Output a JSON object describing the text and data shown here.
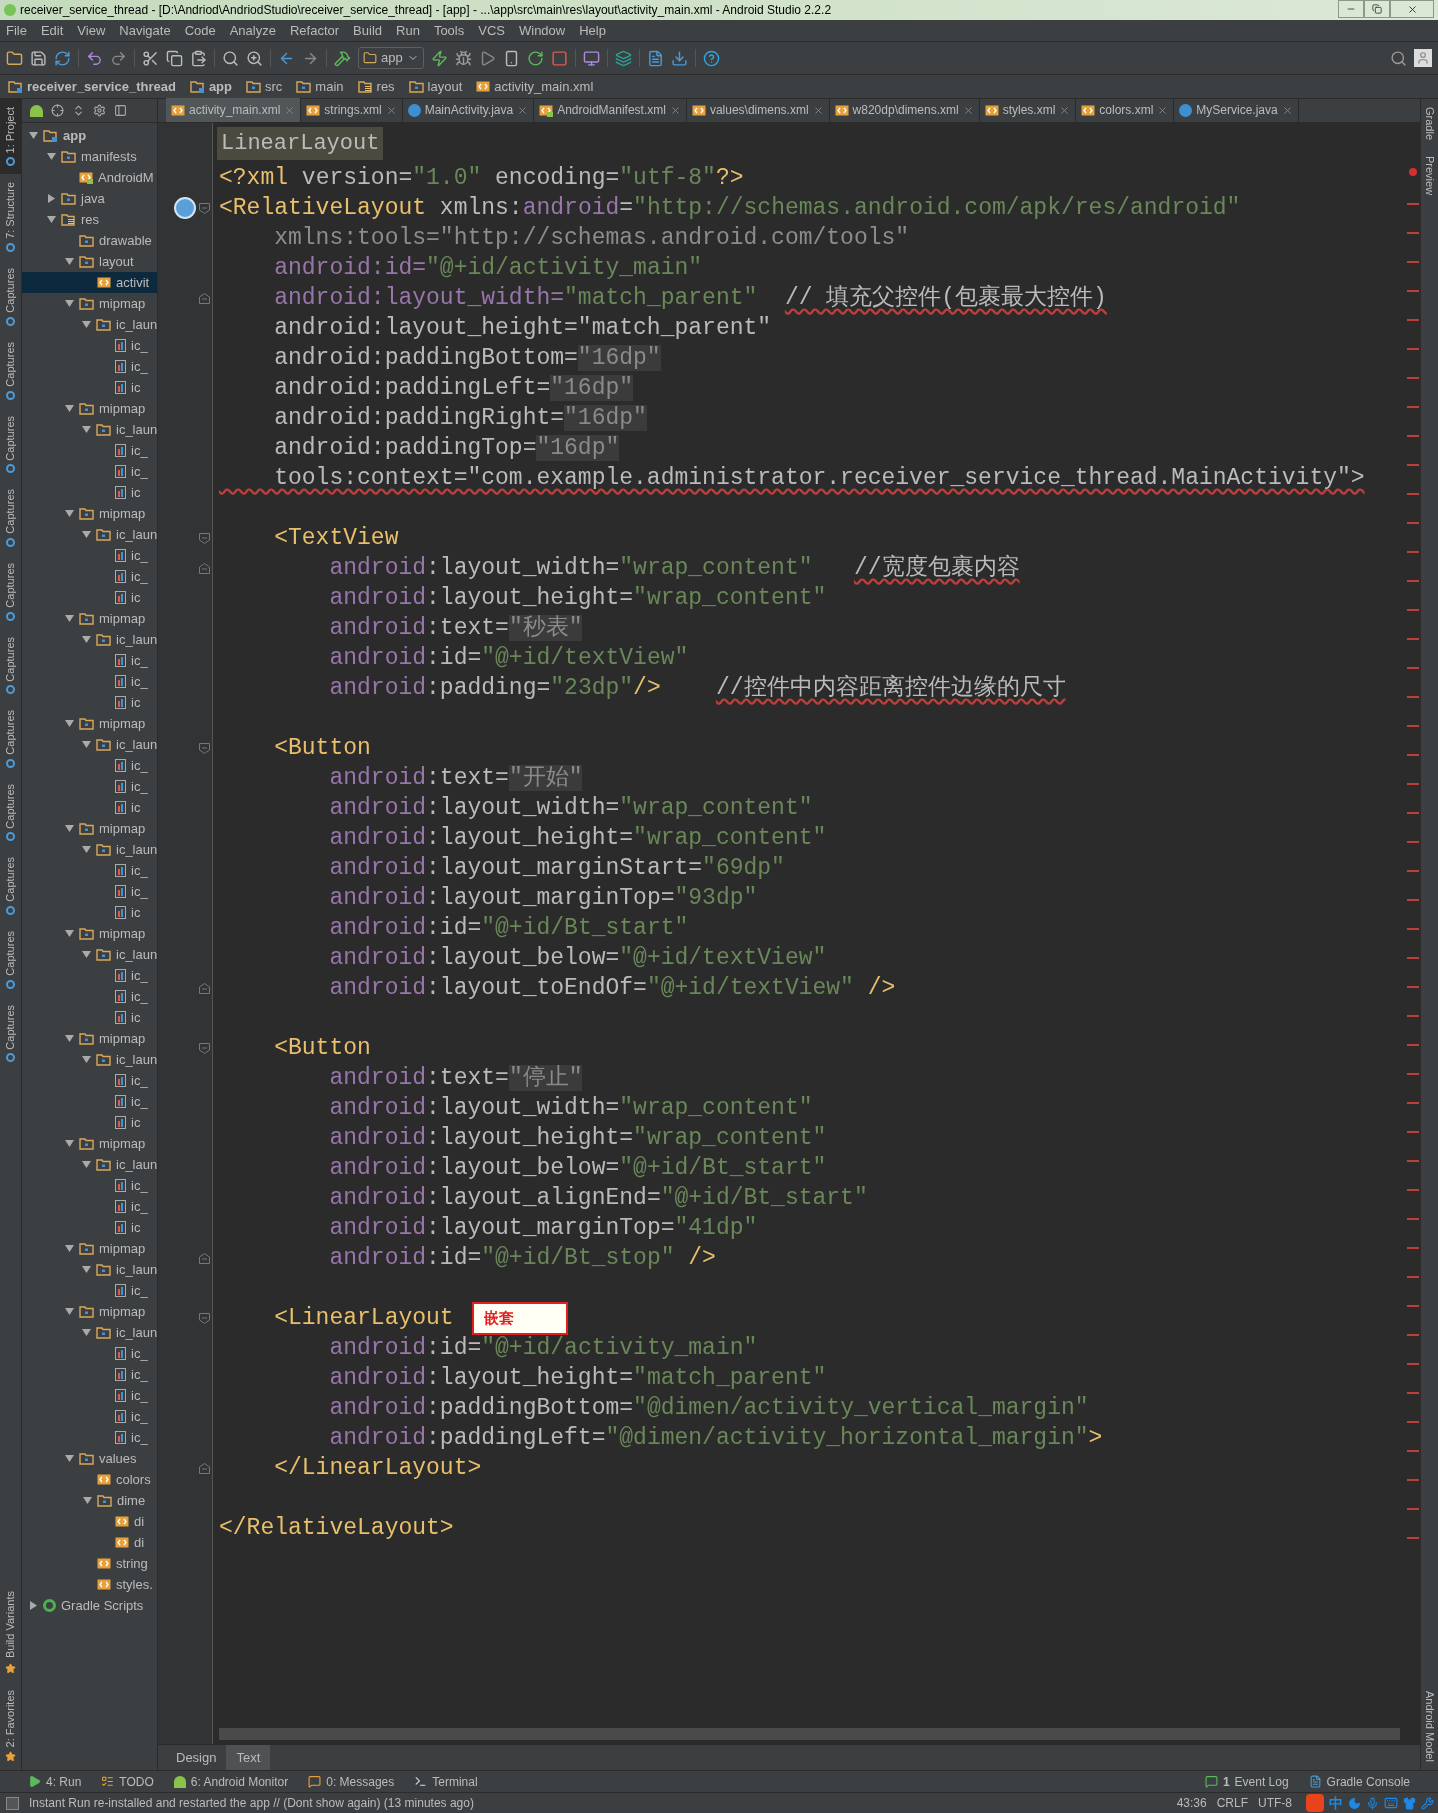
{
  "window": {
    "title": "receiver_service_thread - [D:\\Andriod\\AndriodStudio\\receiver_service_thread] - [app] - ...\\app\\src\\main\\res\\layout\\activity_main.xml - Android Studio 2.2.2"
  },
  "menu": [
    "File",
    "Edit",
    "View",
    "Navigate",
    "Code",
    "Analyze",
    "Refactor",
    "Build",
    "Run",
    "Tools",
    "VCS",
    "Window",
    "Help"
  ],
  "toolbar": {
    "run_config": "app"
  },
  "breadcrumbs": [
    {
      "label": "receiver_service_thread",
      "kind": "module"
    },
    {
      "label": "app",
      "kind": "module"
    },
    {
      "label": "src",
      "kind": "folder"
    },
    {
      "label": "main",
      "kind": "folder"
    },
    {
      "label": "res",
      "kind": "res"
    },
    {
      "label": "layout",
      "kind": "folder"
    },
    {
      "label": "activity_main.xml",
      "kind": "xml"
    }
  ],
  "left_strip": {
    "top": [
      {
        "label": "1: Project",
        "selected": true
      },
      {
        "label": "7: Structure",
        "selected": false
      },
      {
        "label": "Captures",
        "selected": false
      },
      {
        "label": "Captures",
        "selected": false
      },
      {
        "label": "Captures",
        "selected": false
      },
      {
        "label": "Captures",
        "selected": false
      },
      {
        "label": "Captures",
        "selected": false
      },
      {
        "label": "Captures",
        "selected": false
      },
      {
        "label": "Captures",
        "selected": false
      },
      {
        "label": "Captures",
        "selected": false
      },
      {
        "label": "Captures",
        "selected": false
      },
      {
        "label": "Captures",
        "selected": false
      },
      {
        "label": "Captures",
        "selected": false
      }
    ],
    "bottom": [
      {
        "label": "Build Variants",
        "selected": false
      },
      {
        "label": "2: Favorites",
        "selected": false
      }
    ]
  },
  "right_strip": {
    "top": [
      {
        "label": "Gradle"
      },
      {
        "label": "Preview"
      }
    ],
    "bottom": [
      {
        "label": "Android Model"
      }
    ]
  },
  "tree": [
    {
      "label": "app",
      "kind": "module",
      "expanded": true,
      "selected": false,
      "children": [
        {
          "label": "manifests",
          "kind": "folder",
          "expanded": true,
          "selected": false,
          "children": [
            {
              "label": "AndroidM",
              "kind": "manifest",
              "selected": false
            }
          ]
        },
        {
          "label": "java",
          "kind": "folder",
          "expanded": false,
          "selected": false
        },
        {
          "label": "res",
          "kind": "res",
          "expanded": true,
          "selected": false,
          "children": [
            {
              "label": "drawable",
              "kind": "folder",
              "selected": false
            },
            {
              "label": "layout",
              "kind": "folder",
              "expanded": true,
              "selected": false,
              "children": [
                {
                  "label": "activit",
                  "kind": "xml",
                  "selected": true
                }
              ]
            },
            {
              "label": "mipmap",
              "kind": "folder",
              "expanded": true,
              "selected": false,
              "children": [
                {
                  "label": "ic_laun",
                  "kind": "folder",
                  "expanded": true,
                  "selected": false,
                  "children": [
                    {
                      "label": "ic_",
                      "kind": "image",
                      "selected": false
                    },
                    {
                      "label": "ic_",
                      "kind": "image",
                      "selected": false
                    },
                    {
                      "label": "ic",
                      "kind": "image",
                      "selected": false
                    }
                  ]
                }
              ]
            },
            {
              "label": "mipmap",
              "kind": "folder",
              "expanded": true,
              "selected": false,
              "children": [
                {
                  "label": "ic_laun",
                  "kind": "folder",
                  "expanded": true,
                  "selected": false,
                  "children": [
                    {
                      "label": "ic_",
                      "kind": "image",
                      "selected": false
                    },
                    {
                      "label": "ic_",
                      "kind": "image",
                      "selected": false
                    },
                    {
                      "label": "ic",
                      "kind": "image",
                      "selected": false
                    }
                  ]
                }
              ]
            },
            {
              "label": "mipmap",
              "kind": "folder",
              "expanded": true,
              "selected": false,
              "children": [
                {
                  "label": "ic_laun",
                  "kind": "folder",
                  "expanded": true,
                  "selected": false,
                  "children": [
                    {
                      "label": "ic_",
                      "kind": "image",
                      "selected": false
                    },
                    {
                      "label": "ic_",
                      "kind": "image",
                      "selected": false
                    },
                    {
                      "label": "ic",
                      "kind": "image",
                      "selected": false
                    }
                  ]
                }
              ]
            },
            {
              "label": "mipmap",
              "kind": "folder",
              "expanded": true,
              "selected": false,
              "children": [
                {
                  "label": "ic_laun",
                  "kind": "folder",
                  "expanded": true,
                  "selected": false,
                  "children": [
                    {
                      "label": "ic_",
                      "kind": "image",
                      "selected": false
                    },
                    {
                      "label": "ic_",
                      "kind": "image",
                      "selected": false
                    },
                    {
                      "label": "ic",
                      "kind": "image",
                      "selected": false
                    }
                  ]
                }
              ]
            },
            {
              "label": "mipmap",
              "kind": "folder",
              "expanded": true,
              "selected": false,
              "children": [
                {
                  "label": "ic_laun",
                  "kind": "folder",
                  "expanded": true,
                  "selected": false,
                  "children": [
                    {
                      "label": "ic_",
                      "kind": "image",
                      "selected": false
                    },
                    {
                      "label": "ic_",
                      "kind": "image",
                      "selected": false
                    },
                    {
                      "label": "ic",
                      "kind": "image",
                      "selected": false
                    }
                  ]
                }
              ]
            },
            {
              "label": "mipmap",
              "kind": "folder",
              "expanded": true,
              "selected": false,
              "children": [
                {
                  "label": "ic_laun",
                  "kind": "folder",
                  "expanded": true,
                  "selected": false,
                  "children": [
                    {
                      "label": "ic_",
                      "kind": "image",
                      "selected": false
                    },
                    {
                      "label": "ic_",
                      "kind": "image",
                      "selected": false
                    },
                    {
                      "label": "ic",
                      "kind": "image",
                      "selected": false
                    }
                  ]
                }
              ]
            },
            {
              "label": "mipmap",
              "kind": "folder",
              "expanded": true,
              "selected": false,
              "children": [
                {
                  "label": "ic_laun",
                  "kind": "folder",
                  "expanded": true,
                  "selected": false,
                  "children": [
                    {
                      "label": "ic_",
                      "kind": "image",
                      "selected": false
                    },
                    {
                      "label": "ic_",
                      "kind": "image",
                      "selected": false
                    },
                    {
                      "label": "ic",
                      "kind": "image",
                      "selected": false
                    }
                  ]
                }
              ]
            },
            {
              "label": "mipmap",
              "kind": "folder",
              "expanded": true,
              "selected": false,
              "children": [
                {
                  "label": "ic_laun",
                  "kind": "folder",
                  "expanded": true,
                  "selected": false,
                  "children": [
                    {
                      "label": "ic_",
                      "kind": "image",
                      "selected": false
                    },
                    {
                      "label": "ic_",
                      "kind": "image",
                      "selected": false
                    },
                    {
                      "label": "ic",
                      "kind": "image",
                      "selected": false
                    }
                  ]
                }
              ]
            },
            {
              "label": "mipmap",
              "kind": "folder",
              "expanded": true,
              "selected": false,
              "children": [
                {
                  "label": "ic_laun",
                  "kind": "folder",
                  "expanded": true,
                  "selected": false,
                  "children": [
                    {
                      "label": "ic_",
                      "kind": "image",
                      "selected": false
                    },
                    {
                      "label": "ic_",
                      "kind": "image",
                      "selected": false
                    },
                    {
                      "label": "ic",
                      "kind": "image",
                      "selected": false
                    }
                  ]
                }
              ]
            },
            {
              "label": "mipmap",
              "kind": "folder",
              "expanded": true,
              "selected": false,
              "children": [
                {
                  "label": "ic_laun",
                  "kind": "folder",
                  "expanded": true,
                  "selected": false,
                  "children": [
                    {
                      "label": "ic_",
                      "kind": "image",
                      "selected": false
                    }
                  ]
                }
              ]
            },
            {
              "label": "mipmap",
              "kind": "folder",
              "expanded": true,
              "selected": false,
              "children": [
                {
                  "label": "ic_laun",
                  "kind": "folder",
                  "expanded": true,
                  "selected": false,
                  "children": [
                    {
                      "label": "ic_",
                      "kind": "image",
                      "selected": false
                    },
                    {
                      "label": "ic_",
                      "kind": "image",
                      "selected": false
                    },
                    {
                      "label": "ic_",
                      "kind": "image",
                      "selected": false
                    },
                    {
                      "label": "ic_",
                      "kind": "image",
                      "selected": false
                    },
                    {
                      "label": "ic_",
                      "kind": "image",
                      "selected": false
                    }
                  ]
                }
              ]
            },
            {
              "label": "values",
              "kind": "folder",
              "expanded": true,
              "selected": false,
              "children": [
                {
                  "label": "colors",
                  "kind": "xml",
                  "selected": false
                },
                {
                  "label": "dime",
                  "kind": "folder",
                  "expanded": true,
                  "selected": false,
                  "children": [
                    {
                      "label": "di",
                      "kind": "xml",
                      "selected": false
                    },
                    {
                      "label": "di",
                      "kind": "xml",
                      "selected": false
                    }
                  ]
                },
                {
                  "label": "string",
                  "kind": "xml",
                  "selected": false
                },
                {
                  "label": "styles.",
                  "kind": "xml",
                  "selected": false
                }
              ]
            }
          ]
        }
      ]
    },
    {
      "label": "Gradle Scripts",
      "kind": "gradle",
      "expanded": false,
      "selected": false
    }
  ],
  "tabs": [
    {
      "label": "activity_main.xml",
      "kind": "xml",
      "selected": true
    },
    {
      "label": "strings.xml",
      "kind": "xml",
      "selected": false
    },
    {
      "label": "MainActivity.java",
      "kind": "class",
      "selected": false
    },
    {
      "label": "AndroidManifest.xml",
      "kind": "manifest",
      "selected": false
    },
    {
      "label": "values\\dimens.xml",
      "kind": "xml",
      "selected": false
    },
    {
      "label": "w820dp\\dimens.xml",
      "kind": "xml",
      "selected": false
    },
    {
      "label": "styles.xml",
      "kind": "xml",
      "selected": false
    },
    {
      "label": "colors.xml",
      "kind": "xml",
      "selected": false
    },
    {
      "label": "MyService.java",
      "kind": "class",
      "selected": false
    }
  ],
  "editor": {
    "breadcrumb": "LinearLayout",
    "lines": [
      {
        "kind": "code",
        "tokens": [
          {
            "kind": "tag",
            "text": "<?xml "
          },
          {
            "kind": "attr",
            "text": "version="
          },
          {
            "kind": "value",
            "text": "\"1.0\""
          },
          {
            "kind": "attr",
            "text": " encoding="
          },
          {
            "kind": "value",
            "text": "\"utf-8\""
          },
          {
            "kind": "tag",
            "text": "?>"
          }
        ]
      },
      {
        "kind": "class_open",
        "tokens": [
          {
            "kind": "tag",
            "text": "<RelativeLayout"
          },
          {
            "kind": "attr",
            "text": " xmlns:"
          },
          {
            "kind": "ns",
            "text": "android"
          },
          {
            "kind": "attr",
            "text": "="
          },
          {
            "kind": "value",
            "text": "\"http://schemas.android.com/apk/res/android\""
          }
        ]
      },
      {
        "kind": "code",
        "tokens": [
          {
            "kind": "dim",
            "text": "    xmlns:tools=\"http://schemas.android.com/tools\""
          }
        ]
      },
      {
        "kind": "code",
        "tokens": [
          {
            "kind": "ns",
            "text": "    android"
          },
          {
            "kind": "ns",
            "text": ":id="
          },
          {
            "kind": "value",
            "text": "\"@+id/activity_main\""
          }
        ]
      },
      {
        "kind": "close",
        "tokens": [
          {
            "kind": "ns",
            "text": "    android"
          },
          {
            "kind": "ns",
            "text": ":layout_width="
          },
          {
            "kind": "value",
            "text": "\"match_parent\"  "
          },
          {
            "kind": "note",
            "text": "// 填充父控件(包裹最大控件)"
          }
        ]
      },
      {
        "kind": "code",
        "tokens": [
          {
            "kind": "plain",
            "text": "    android:layout_height=\"match_parent\""
          }
        ]
      },
      {
        "kind": "code",
        "tokens": [
          {
            "kind": "plain",
            "text": "    android:paddingBottom="
          },
          {
            "kind": "marked",
            "text": "\"16dp\""
          }
        ]
      },
      {
        "kind": "code",
        "tokens": [
          {
            "kind": "plain",
            "text": "    android:paddingLeft="
          },
          {
            "kind": "marked",
            "text": "\"16dp\""
          }
        ]
      },
      {
        "kind": "code",
        "tokens": [
          {
            "kind": "plain",
            "text": "    android:paddingRight="
          },
          {
            "kind": "marked",
            "text": "\"16dp\""
          }
        ]
      },
      {
        "kind": "code",
        "tokens": [
          {
            "kind": "plain",
            "text": "    android:paddingTop="
          },
          {
            "kind": "marked",
            "text": "\"16dp\""
          }
        ]
      },
      {
        "kind": "code",
        "tokens": [
          {
            "kind": "note",
            "text": "    tools:context=\"com.example.administrator.receiver_service_thread.MainActivity\">"
          }
        ]
      },
      {
        "kind": "blank"
      },
      {
        "kind": "open",
        "tokens": [
          {
            "kind": "tag",
            "text": "    <TextView"
          }
        ]
      },
      {
        "kind": "close",
        "tokens": [
          {
            "kind": "ns",
            "text": "        android"
          },
          {
            "kind": "attr",
            "text": ":layout_width="
          },
          {
            "kind": "value",
            "text": "\"wrap_content\"   "
          },
          {
            "kind": "note",
            "text": "//宽度包裹内容"
          }
        ]
      },
      {
        "kind": "code",
        "tokens": [
          {
            "kind": "ns",
            "text": "        android"
          },
          {
            "kind": "attr",
            "text": ":layout_height="
          },
          {
            "kind": "value",
            "text": "\"wrap_content\""
          }
        ]
      },
      {
        "kind": "code",
        "tokens": [
          {
            "kind": "ns",
            "text": "        android"
          },
          {
            "kind": "attr",
            "text": ":text="
          },
          {
            "kind": "marked",
            "text": "\"秒表\""
          }
        ]
      },
      {
        "kind": "code",
        "tokens": [
          {
            "kind": "ns",
            "text": "        android"
          },
          {
            "kind": "attr",
            "text": ":id="
          },
          {
            "kind": "value",
            "text": "\"@+id/textView\""
          }
        ]
      },
      {
        "kind": "code",
        "tokens": [
          {
            "kind": "ns",
            "text": "        android"
          },
          {
            "kind": "attr",
            "text": ":padding="
          },
          {
            "kind": "value",
            "text": "\"23dp\""
          },
          {
            "kind": "tag",
            "text": "/>    "
          },
          {
            "kind": "note",
            "text": "//控件中内容距离控件边缘的尺寸"
          }
        ]
      },
      {
        "kind": "blank"
      },
      {
        "kind": "open",
        "tokens": [
          {
            "kind": "tag",
            "text": "    <Button"
          }
        ]
      },
      {
        "kind": "code",
        "tokens": [
          {
            "kind": "ns",
            "text": "        android"
          },
          {
            "kind": "attr",
            "text": ":text="
          },
          {
            "kind": "marked",
            "text": "\"开始\""
          }
        ]
      },
      {
        "kind": "code",
        "tokens": [
          {
            "kind": "ns",
            "text": "        android"
          },
          {
            "kind": "attr",
            "text": ":layout_width="
          },
          {
            "kind": "value",
            "text": "\"wrap_content\""
          }
        ]
      },
      {
        "kind": "code",
        "tokens": [
          {
            "kind": "ns",
            "text": "        android"
          },
          {
            "kind": "attr",
            "text": ":layout_height="
          },
          {
            "kind": "value",
            "text": "\"wrap_content\""
          }
        ]
      },
      {
        "kind": "code",
        "tokens": [
          {
            "kind": "ns",
            "text": "        android"
          },
          {
            "kind": "attr",
            "text": ":layout_marginStart="
          },
          {
            "kind": "value",
            "text": "\"69dp\""
          }
        ]
      },
      {
        "kind": "code",
        "tokens": [
          {
            "kind": "ns",
            "text": "        android"
          },
          {
            "kind": "attr",
            "text": ":layout_marginTop="
          },
          {
            "kind": "value",
            "text": "\"93dp\""
          }
        ]
      },
      {
        "kind": "code",
        "tokens": [
          {
            "kind": "ns",
            "text": "        android"
          },
          {
            "kind": "attr",
            "text": ":id="
          },
          {
            "kind": "value",
            "text": "\"@+id/Bt_start\""
          }
        ]
      },
      {
        "kind": "code",
        "tokens": [
          {
            "kind": "ns",
            "text": "        android"
          },
          {
            "kind": "attr",
            "text": ":layout_below="
          },
          {
            "kind": "value",
            "text": "\"@+id/textView\""
          }
        ]
      },
      {
        "kind": "close",
        "tokens": [
          {
            "kind": "ns",
            "text": "        android"
          },
          {
            "kind": "attr",
            "text": ":layout_toEndOf="
          },
          {
            "kind": "value",
            "text": "\"@+id/textView\""
          },
          {
            "kind": "tag",
            "text": " />"
          }
        ]
      },
      {
        "kind": "blank"
      },
      {
        "kind": "open",
        "tokens": [
          {
            "kind": "tag",
            "text": "    <Button"
          }
        ]
      },
      {
        "kind": "code",
        "tokens": [
          {
            "kind": "ns",
            "text": "        android"
          },
          {
            "kind": "attr",
            "text": ":text="
          },
          {
            "kind": "marked",
            "text": "\"停止\""
          }
        ]
      },
      {
        "kind": "code",
        "tokens": [
          {
            "kind": "ns",
            "text": "        android"
          },
          {
            "kind": "attr",
            "text": ":layout_width="
          },
          {
            "kind": "value",
            "text": "\"wrap_content\""
          }
        ]
      },
      {
        "kind": "code",
        "tokens": [
          {
            "kind": "ns",
            "text": "        android"
          },
          {
            "kind": "attr",
            "text": ":layout_height="
          },
          {
            "kind": "value",
            "text": "\"wrap_content\""
          }
        ]
      },
      {
        "kind": "code",
        "tokens": [
          {
            "kind": "ns",
            "text": "        android"
          },
          {
            "kind": "attr",
            "text": ":layout_below="
          },
          {
            "kind": "value",
            "text": "\"@+id/Bt_start\""
          }
        ]
      },
      {
        "kind": "code",
        "tokens": [
          {
            "kind": "ns",
            "text": "        android"
          },
          {
            "kind": "attr",
            "text": ":layout_alignEnd="
          },
          {
            "kind": "value",
            "text": "\"@+id/Bt_start\""
          }
        ]
      },
      {
        "kind": "code",
        "tokens": [
          {
            "kind": "ns",
            "text": "        android"
          },
          {
            "kind": "attr",
            "text": ":layout_marginTop="
          },
          {
            "kind": "value",
            "text": "\"41dp\""
          }
        ]
      },
      {
        "kind": "close",
        "tokens": [
          {
            "kind": "ns",
            "text": "        android"
          },
          {
            "kind": "attr",
            "text": ":id="
          },
          {
            "kind": "value",
            "text": "\"@+id/Bt_stop\""
          },
          {
            "kind": "tag",
            "text": " />"
          }
        ]
      },
      {
        "kind": "blank"
      },
      {
        "kind": "open",
        "annotation": "嵌套",
        "tokens": [
          {
            "kind": "tag",
            "text": "    <LinearLayout"
          }
        ]
      },
      {
        "kind": "code",
        "tokens": [
          {
            "kind": "ns",
            "text": "        android"
          },
          {
            "kind": "attr",
            "text": ":id="
          },
          {
            "kind": "value",
            "text": "\"@+id/activity_main\""
          }
        ]
      },
      {
        "kind": "code",
        "tokens": [
          {
            "kind": "ns",
            "text": "        android"
          },
          {
            "kind": "attr",
            "text": ":layout_height="
          },
          {
            "kind": "value",
            "text": "\"match_parent\""
          }
        ]
      },
      {
        "kind": "code",
        "tokens": [
          {
            "kind": "ns",
            "text": "        android"
          },
          {
            "kind": "attr",
            "text": ":paddingBottom="
          },
          {
            "kind": "value",
            "text": "\"@dimen/activity_vertical_margin\""
          }
        ]
      },
      {
        "kind": "code",
        "tokens": [
          {
            "kind": "ns",
            "text": "        android"
          },
          {
            "kind": "attr",
            "text": ":paddingLeft="
          },
          {
            "kind": "value",
            "text": "\"@dimen/activity_horizontal_margin\""
          },
          {
            "kind": "tag",
            "text": ">"
          }
        ]
      },
      {
        "kind": "close",
        "tokens": [
          {
            "kind": "tag",
            "text": "    </LinearLayout>"
          }
        ]
      },
      {
        "kind": "blank"
      },
      {
        "kind": "code",
        "tokens": [
          {
            "kind": "tag",
            "text": "</RelativeLayout>"
          }
        ]
      }
    ]
  },
  "view_tabs": [
    {
      "label": "Design",
      "selected": false
    },
    {
      "label": "Text",
      "selected": true
    }
  ],
  "tool_windows": {
    "left": [
      {
        "label": "4: Run",
        "kind": "run"
      },
      {
        "label": "TODO",
        "kind": "todo"
      },
      {
        "label": "6: Android Monitor",
        "kind": "android"
      },
      {
        "label": "0: Messages",
        "kind": "messages"
      },
      {
        "label": "Terminal",
        "kind": "terminal"
      }
    ],
    "right": [
      {
        "label": "Event Log",
        "count": "1",
        "kind": "event"
      },
      {
        "label": "Gradle Console",
        "kind": "console"
      }
    ]
  },
  "status_bar": {
    "message": "Instant Run re-installed and restarted the app // (Dont show again) (13 minutes ago)",
    "position": "43:36",
    "line_separator": "CRLF",
    "encoding": "UTF-8",
    "ime": "中"
  }
}
